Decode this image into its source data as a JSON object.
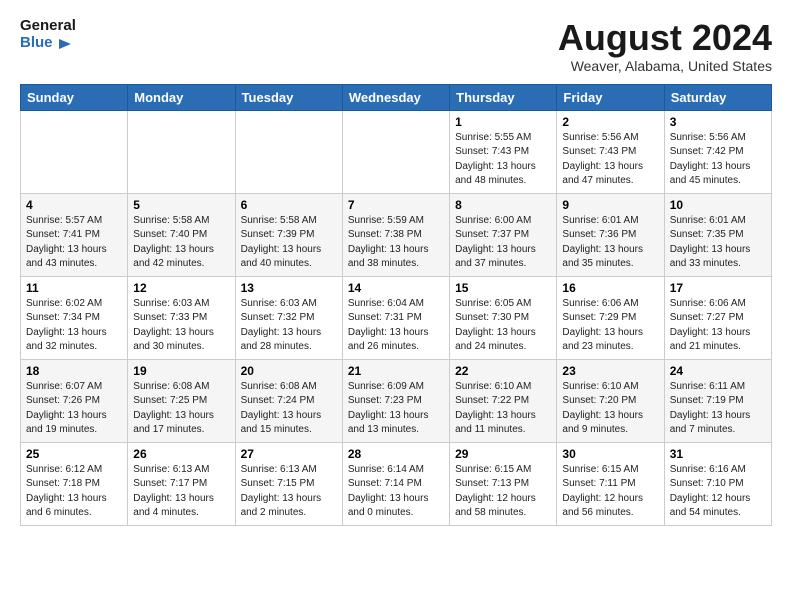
{
  "logo": {
    "line1": "General",
    "line2": "Blue"
  },
  "title": "August 2024",
  "location": "Weaver, Alabama, United States",
  "days_of_week": [
    "Sunday",
    "Monday",
    "Tuesday",
    "Wednesday",
    "Thursday",
    "Friday",
    "Saturday"
  ],
  "weeks": [
    [
      {
        "day": "",
        "info": ""
      },
      {
        "day": "",
        "info": ""
      },
      {
        "day": "",
        "info": ""
      },
      {
        "day": "",
        "info": ""
      },
      {
        "day": "1",
        "info": "Sunrise: 5:55 AM\nSunset: 7:43 PM\nDaylight: 13 hours\nand 48 minutes."
      },
      {
        "day": "2",
        "info": "Sunrise: 5:56 AM\nSunset: 7:43 PM\nDaylight: 13 hours\nand 47 minutes."
      },
      {
        "day": "3",
        "info": "Sunrise: 5:56 AM\nSunset: 7:42 PM\nDaylight: 13 hours\nand 45 minutes."
      }
    ],
    [
      {
        "day": "4",
        "info": "Sunrise: 5:57 AM\nSunset: 7:41 PM\nDaylight: 13 hours\nand 43 minutes."
      },
      {
        "day": "5",
        "info": "Sunrise: 5:58 AM\nSunset: 7:40 PM\nDaylight: 13 hours\nand 42 minutes."
      },
      {
        "day": "6",
        "info": "Sunrise: 5:58 AM\nSunset: 7:39 PM\nDaylight: 13 hours\nand 40 minutes."
      },
      {
        "day": "7",
        "info": "Sunrise: 5:59 AM\nSunset: 7:38 PM\nDaylight: 13 hours\nand 38 minutes."
      },
      {
        "day": "8",
        "info": "Sunrise: 6:00 AM\nSunset: 7:37 PM\nDaylight: 13 hours\nand 37 minutes."
      },
      {
        "day": "9",
        "info": "Sunrise: 6:01 AM\nSunset: 7:36 PM\nDaylight: 13 hours\nand 35 minutes."
      },
      {
        "day": "10",
        "info": "Sunrise: 6:01 AM\nSunset: 7:35 PM\nDaylight: 13 hours\nand 33 minutes."
      }
    ],
    [
      {
        "day": "11",
        "info": "Sunrise: 6:02 AM\nSunset: 7:34 PM\nDaylight: 13 hours\nand 32 minutes."
      },
      {
        "day": "12",
        "info": "Sunrise: 6:03 AM\nSunset: 7:33 PM\nDaylight: 13 hours\nand 30 minutes."
      },
      {
        "day": "13",
        "info": "Sunrise: 6:03 AM\nSunset: 7:32 PM\nDaylight: 13 hours\nand 28 minutes."
      },
      {
        "day": "14",
        "info": "Sunrise: 6:04 AM\nSunset: 7:31 PM\nDaylight: 13 hours\nand 26 minutes."
      },
      {
        "day": "15",
        "info": "Sunrise: 6:05 AM\nSunset: 7:30 PM\nDaylight: 13 hours\nand 24 minutes."
      },
      {
        "day": "16",
        "info": "Sunrise: 6:06 AM\nSunset: 7:29 PM\nDaylight: 13 hours\nand 23 minutes."
      },
      {
        "day": "17",
        "info": "Sunrise: 6:06 AM\nSunset: 7:27 PM\nDaylight: 13 hours\nand 21 minutes."
      }
    ],
    [
      {
        "day": "18",
        "info": "Sunrise: 6:07 AM\nSunset: 7:26 PM\nDaylight: 13 hours\nand 19 minutes."
      },
      {
        "day": "19",
        "info": "Sunrise: 6:08 AM\nSunset: 7:25 PM\nDaylight: 13 hours\nand 17 minutes."
      },
      {
        "day": "20",
        "info": "Sunrise: 6:08 AM\nSunset: 7:24 PM\nDaylight: 13 hours\nand 15 minutes."
      },
      {
        "day": "21",
        "info": "Sunrise: 6:09 AM\nSunset: 7:23 PM\nDaylight: 13 hours\nand 13 minutes."
      },
      {
        "day": "22",
        "info": "Sunrise: 6:10 AM\nSunset: 7:22 PM\nDaylight: 13 hours\nand 11 minutes."
      },
      {
        "day": "23",
        "info": "Sunrise: 6:10 AM\nSunset: 7:20 PM\nDaylight: 13 hours\nand 9 minutes."
      },
      {
        "day": "24",
        "info": "Sunrise: 6:11 AM\nSunset: 7:19 PM\nDaylight: 13 hours\nand 7 minutes."
      }
    ],
    [
      {
        "day": "25",
        "info": "Sunrise: 6:12 AM\nSunset: 7:18 PM\nDaylight: 13 hours\nand 6 minutes."
      },
      {
        "day": "26",
        "info": "Sunrise: 6:13 AM\nSunset: 7:17 PM\nDaylight: 13 hours\nand 4 minutes."
      },
      {
        "day": "27",
        "info": "Sunrise: 6:13 AM\nSunset: 7:15 PM\nDaylight: 13 hours\nand 2 minutes."
      },
      {
        "day": "28",
        "info": "Sunrise: 6:14 AM\nSunset: 7:14 PM\nDaylight: 13 hours\nand 0 minutes."
      },
      {
        "day": "29",
        "info": "Sunrise: 6:15 AM\nSunset: 7:13 PM\nDaylight: 12 hours\nand 58 minutes."
      },
      {
        "day": "30",
        "info": "Sunrise: 6:15 AM\nSunset: 7:11 PM\nDaylight: 12 hours\nand 56 minutes."
      },
      {
        "day": "31",
        "info": "Sunrise: 6:16 AM\nSunset: 7:10 PM\nDaylight: 12 hours\nand 54 minutes."
      }
    ]
  ]
}
